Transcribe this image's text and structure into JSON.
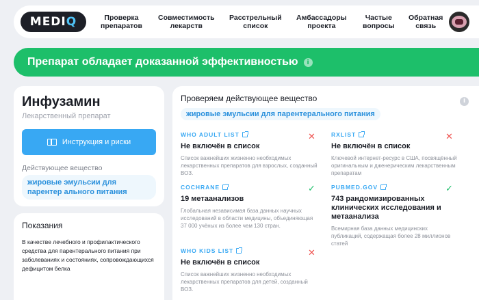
{
  "header": {
    "logo_left": "MEDI",
    "logo_right": "Q",
    "nav": [
      {
        "line1": "Проверка",
        "line2": "препаратов"
      },
      {
        "line1": "Совместимость",
        "line2": "лекарств"
      },
      {
        "line1": "Расстрельный",
        "line2": "список"
      },
      {
        "line1": "Амбассадоры",
        "line2": "проекта"
      },
      {
        "line1": "Частые",
        "line2": "вопросы"
      },
      {
        "line1": "Обратная",
        "line2": "связь"
      }
    ]
  },
  "banner": {
    "text": "Препарат обладает доказанной эффективностью",
    "icon": "info-icon"
  },
  "drug": {
    "name": "Инфузамин",
    "subtitle": "Лекарственный препарат",
    "instruction_button": "Инструкция и риски",
    "substance_label": "Действующее вещество",
    "substance": "жировые эмульсии для парентер ального питания"
  },
  "indications": {
    "title": "Показания",
    "text": "В качестве лечебного и профилактического средства для парентерального питания при заболеваниях и состояниях, сопровождающихся дефицитом белка"
  },
  "check": {
    "title": "Проверяем действующее вещество",
    "substance": "жировые эмульсии для парентерального питания",
    "sources": [
      {
        "name": "WHO ADULT LIST",
        "value": "Не включён в список",
        "desc": "Список важнейших жизненно необходимых лекарственных препаратов для взрослых, созданный ВОЗ.",
        "status": "negative",
        "status_color": "#ef5350"
      },
      {
        "name": "RXLIST",
        "value": "Не включён в список",
        "desc": "Ключевой интернет-ресурс в США, посвящённый оригинальным и дженерическим лекарственным препаратам",
        "status": "negative",
        "status_color": "#ef5350"
      },
      {
        "name": "COCHRANE",
        "value": "19 метаанализов",
        "desc": "Глобальная независимая база данных научных исследований в области медицины, объединяющая 37 000 учёных из более чем 130 стран.",
        "status": "positive",
        "status_color": "#1dbf6a"
      },
      {
        "name": "PUBMED.GOV",
        "value": "743 рандомизированных клинических исследования и метаанализа",
        "desc": "Всемирная база данных медицинских публикаций, содержащая более 28 миллионов статей",
        "status": "positive",
        "status_color": "#1dbf6a"
      },
      {
        "name": "WHO KIDS LIST",
        "value": "Не включён в список",
        "desc": "Список важнейших жизненно необходимых лекарственных препаратов для детей, созданный ВОЗ.",
        "status": "negative",
        "status_color": "#ef5350"
      }
    ]
  },
  "colors": {
    "accent": "#38a8f3",
    "success": "#1dbf6a",
    "danger": "#ef5350",
    "dark": "#1d1f27"
  }
}
